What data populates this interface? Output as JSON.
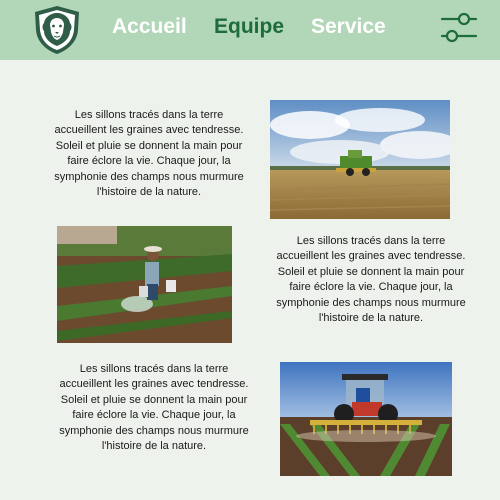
{
  "nav": {
    "items": [
      {
        "label": "Accueil",
        "active": false
      },
      {
        "label": "Equipe",
        "active": true
      },
      {
        "label": "Service",
        "active": false
      }
    ],
    "menu_icon": "sliders-icon",
    "logo_icon": "lion-shield-icon"
  },
  "content": {
    "paragraphs": [
      "Les sillons tracés dans la terre accueillent les graines avec tendresse. Soleil et pluie se donnent la main pour faire éclore la vie. Chaque jour, la symphonie des champs nous murmure l'histoire de la nature.",
      "Les sillons tracés dans la terre accueillent les graines avec tendresse. Soleil et pluie se donnent la main pour faire éclore la vie. Chaque jour, la symphonie des champs nous murmure l'histoire de la nature.",
      "Les sillons tracés dans la terre accueillent les graines avec tendresse. Soleil et pluie se donnent la main pour faire éclore la vie. Chaque jour, la symphonie des champs nous murmure l'histoire de la nature."
    ],
    "photos": [
      "combine-harvester-photo",
      "farmer-watering-photo",
      "tractor-cultivator-photo"
    ]
  },
  "colors": {
    "header_bg": "#b2d7b8",
    "page_bg": "#eef2ec",
    "nav_active": "#1e6b3e",
    "nav_inactive": "#ffffff"
  }
}
